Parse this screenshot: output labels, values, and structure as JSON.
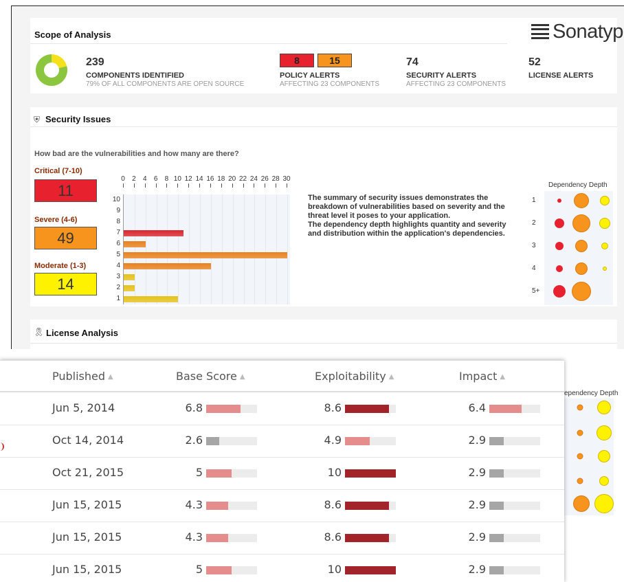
{
  "scope": {
    "title": "Scope of Analysis",
    "logo_text": "Sonatype",
    "components_count": "239",
    "components_label": "COMPONENTS IDENTIFIED",
    "components_sub": "79% OF ALL COMPONENTS ARE OPEN SOURCE",
    "open_source_fraction": 0.79,
    "policy_critical": "8",
    "policy_severe": "15",
    "policy_label": "POLICY ALERTS",
    "policy_sub": "AFFECTING 23 COMPONENTS",
    "security_count": "74",
    "security_label": "SECURITY ALERTS",
    "security_sub": "AFFECTING 23 COMPONENTS",
    "license_count": "52",
    "license_label": "LICENSE ALERTS"
  },
  "security": {
    "title": "Security Issues",
    "question": "How bad are the vulnerabilities and how many are there?",
    "critical_label": "Critical (7-10)",
    "critical_count": "11",
    "severe_label": "Severe (4-6)",
    "severe_count": "49",
    "moderate_label": "Moderate (1-3)",
    "moderate_count": "14",
    "summary": "The summary of security issues demonstrates the breakdown of vulnerabilities based on severity and the threat level it poses to your application.\nThe dependency depth highlights quantity and severity and distribution within the application's dependencies.",
    "depth_title": "Dependency Depth",
    "depth_rows": [
      "1",
      "2",
      "3",
      "4",
      "5+"
    ],
    "colors": {
      "critical": "#e8212e",
      "severe": "#f7941d",
      "moderate": "#fff200"
    }
  },
  "chart_data": {
    "type": "bar",
    "orientation": "horizontal",
    "x_ticks": [
      "0",
      "2",
      "4",
      "6",
      "8",
      "10",
      "12",
      "14",
      "16",
      "18",
      "20",
      "22",
      "24",
      "26",
      "28",
      "30"
    ],
    "xlim": [
      0,
      30
    ],
    "categories": [
      "10",
      "9",
      "8",
      "7",
      "6",
      "5",
      "4",
      "3",
      "2",
      "1"
    ],
    "values": [
      0,
      0,
      0,
      11,
      4,
      30,
      16,
      2,
      2,
      10
    ],
    "bar_colors": [
      "#d9262e",
      "#d9262e",
      "#d9262e",
      "#d9262e",
      "#e8821e",
      "#e8821e",
      "#e8821e",
      "#e6c21a",
      "#e6c21a",
      "#e6c21a"
    ],
    "grid": true
  },
  "license": {
    "title": "License Analysis"
  },
  "table": {
    "headers": {
      "published": "Published",
      "base_score": "Base Score",
      "exploitability": "Exploitability",
      "impact": "Impact"
    },
    "sort_icon": "sort-icon",
    "rows": [
      {
        "published": "Jun 5, 2014",
        "base": "6.8",
        "base_v": 6.8,
        "expl": "8.6",
        "expl_v": 8.6,
        "impact": "6.4",
        "impact_v": 6.4
      },
      {
        "published": "Oct 14, 2014",
        "base": "2.6",
        "base_v": 2.6,
        "expl": "4.9",
        "expl_v": 4.9,
        "impact": "2.9",
        "impact_v": 2.9
      },
      {
        "published": "Oct 21, 2015",
        "base": "5",
        "base_v": 5,
        "expl": "10",
        "expl_v": 10,
        "impact": "2.9",
        "impact_v": 2.9
      },
      {
        "published": "Jun 15, 2015",
        "base": "4.3",
        "base_v": 4.3,
        "expl": "8.6",
        "expl_v": 8.6,
        "impact": "2.9",
        "impact_v": 2.9
      },
      {
        "published": "Jun 15, 2015",
        "base": "4.3",
        "base_v": 4.3,
        "expl": "8.6",
        "expl_v": 8.6,
        "impact": "2.9",
        "impact_v": 2.9
      },
      {
        "published": "Jun 15, 2015",
        "base": "5",
        "base_v": 5,
        "expl": "10",
        "expl_v": 10,
        "impact": "2.9",
        "impact_v": 2.9
      }
    ],
    "bar_colors": {
      "high": "#a3232a",
      "medium": "#e58c8c",
      "low": "#a6a6a6",
      "track": "#ececec"
    },
    "peek_depth_title": "ependency Depth"
  }
}
